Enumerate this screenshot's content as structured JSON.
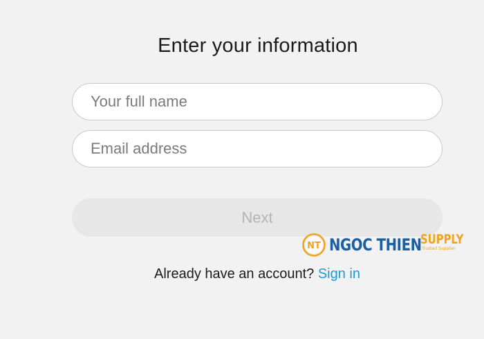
{
  "form": {
    "title": "Enter your information",
    "name_placeholder": "Your full name",
    "name_value": "",
    "email_placeholder": "Email address",
    "email_value": "",
    "next_label": "Next",
    "next_disabled": true
  },
  "signin": {
    "prompt": "Already have an account?",
    "link_label": "Sign in"
  },
  "watermark": {
    "logo_letters": "NT",
    "brand": "NGOC THIEN",
    "brand_suffix": "SUPPLY",
    "tagline": "Trusted Supplier"
  },
  "colors": {
    "background": "#f2f2f2",
    "link": "#1a9ad6",
    "button_disabled_bg": "#e7e7e7",
    "button_disabled_text": "#b4b4b4",
    "brand_blue": "#1b5ea3",
    "brand_orange": "#f0a31f"
  }
}
